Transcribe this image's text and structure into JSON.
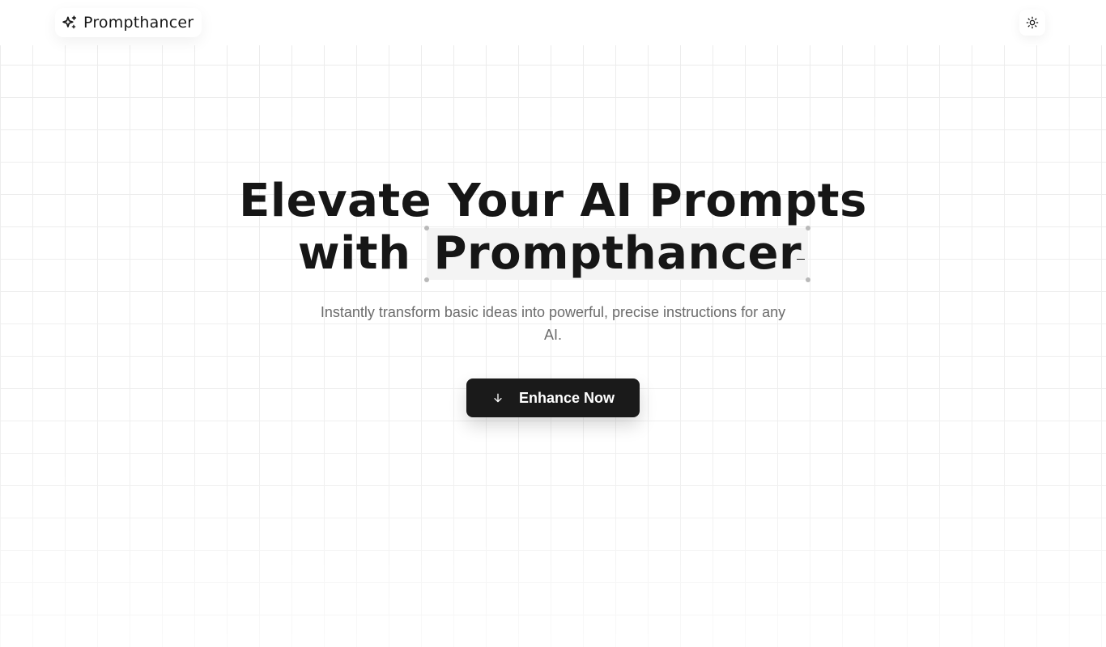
{
  "header": {
    "brand_name": "Prompthancer",
    "brand_icon": "sparkles-icon",
    "theme_toggle_icon": "sun-icon"
  },
  "hero": {
    "title_line1": "Elevate Your AI Prompts",
    "title_line2_prefix": "with",
    "title_highlight": "Prompthancer",
    "subtitle": "Instantly transform basic ideas into powerful, precise instructions for any AI.",
    "cta_label": "Enhance Now",
    "cta_icon": "arrow-down-icon"
  },
  "colors": {
    "text": "#161616",
    "subtitle": "#6b6b6b",
    "button_bg": "#1a1a1a",
    "highlight_bg": "#f4f4f4",
    "grid_line": "#ececec"
  }
}
